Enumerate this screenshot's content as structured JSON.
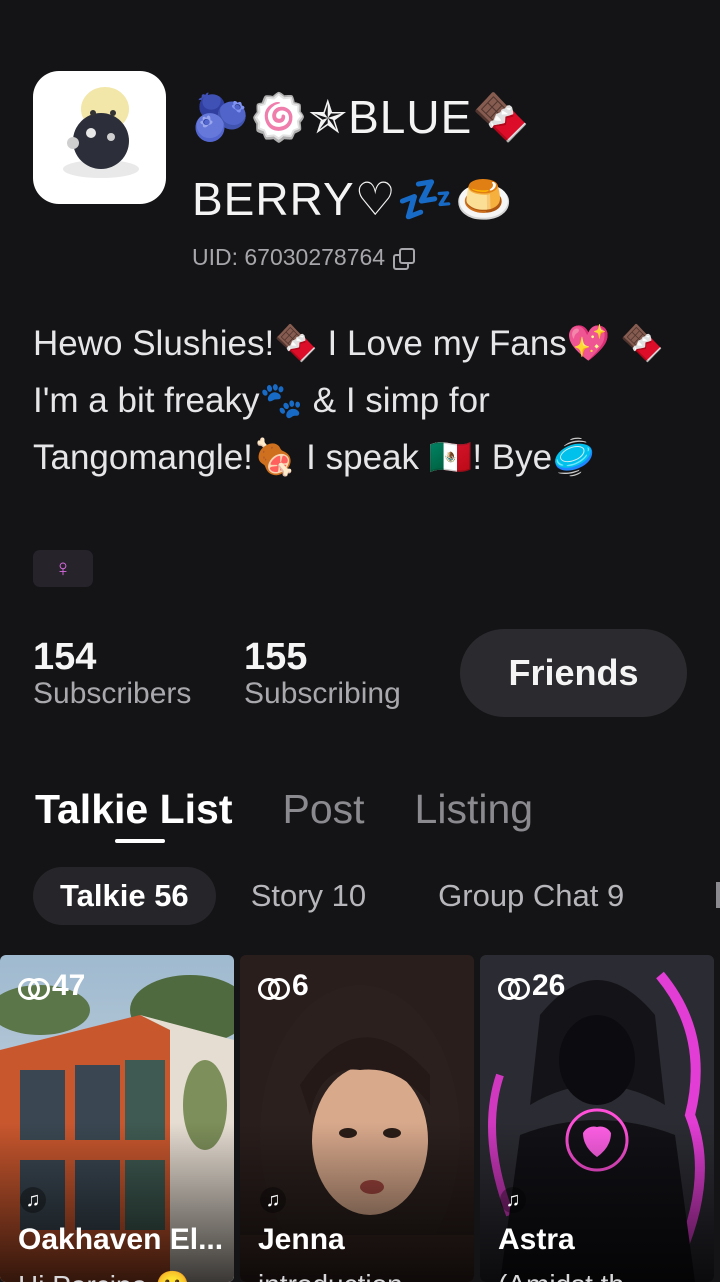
{
  "profile": {
    "display_name": "🫐🍥✯BLUE🍫 BERRY♡💤🍮",
    "uid_label": "UID: 67030278764",
    "bio": "Hewo Slushies!🍫 I Love my Fans💖 🍫I'm a bit freaky🐾 & I simp for Tangomangle!🍖 I speak 🇲🇽! Bye🥏",
    "gender_symbol": "♀"
  },
  "stats": {
    "subscribers": {
      "value": "154",
      "label": "Subscribers"
    },
    "subscribing": {
      "value": "155",
      "label": "Subscribing"
    }
  },
  "actions": {
    "friends_label": "Friends"
  },
  "tabs": [
    {
      "label": "Talkie List",
      "active": true
    },
    {
      "label": "Post",
      "active": false
    },
    {
      "label": "Listing",
      "active": false
    }
  ],
  "chips": [
    {
      "label": "Talkie 56",
      "active": true
    },
    {
      "label": "Story 10",
      "active": false
    },
    {
      "label": "Group Chat 9",
      "active": false
    }
  ],
  "cards": [
    {
      "count": "47",
      "title": "Oakhaven El...",
      "desc": "Hi Parcipa 🙂"
    },
    {
      "count": "6",
      "title": "Jenna",
      "desc": "introduction"
    },
    {
      "count": "26",
      "title": "Astra",
      "desc": "(Amidst th"
    }
  ],
  "colors": {
    "background": "#141416",
    "accent_pink": "#d96ae0",
    "button_bg": "#2b2b2f"
  }
}
